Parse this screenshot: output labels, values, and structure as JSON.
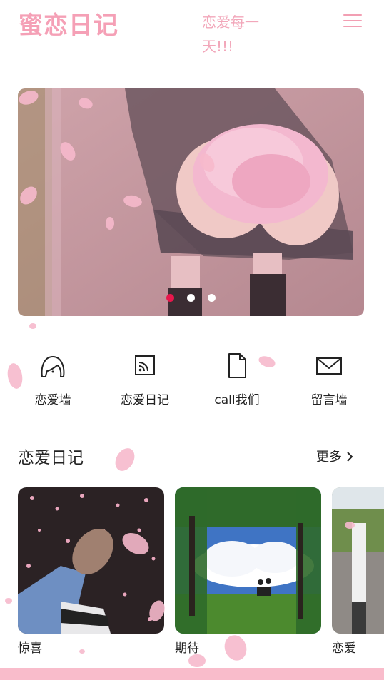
{
  "header": {
    "logo": "蜜恋日记",
    "slogan": "恋爱每一天!!!",
    "menu_icon": "hamburger-menu-icon"
  },
  "banner": {
    "slide_count": 3,
    "active_slide": 1
  },
  "quick_nav": [
    {
      "label": "恋爱墙",
      "icon": "face-icon"
    },
    {
      "label": "恋爱日记",
      "icon": "rss-feed-icon"
    },
    {
      "label": "call我们",
      "icon": "document-icon"
    },
    {
      "label": "留言墙",
      "icon": "mail-icon"
    }
  ],
  "diary_section": {
    "title": "恋爱日记",
    "more_label": "更多",
    "cards": [
      {
        "label": "惊喜"
      },
      {
        "label": "期待"
      },
      {
        "label": "恋爱"
      }
    ]
  },
  "colors": {
    "brand_pink": "#f5a0b6",
    "active_dot": "#e8174c",
    "bottom_bar": "#f9bccb"
  }
}
